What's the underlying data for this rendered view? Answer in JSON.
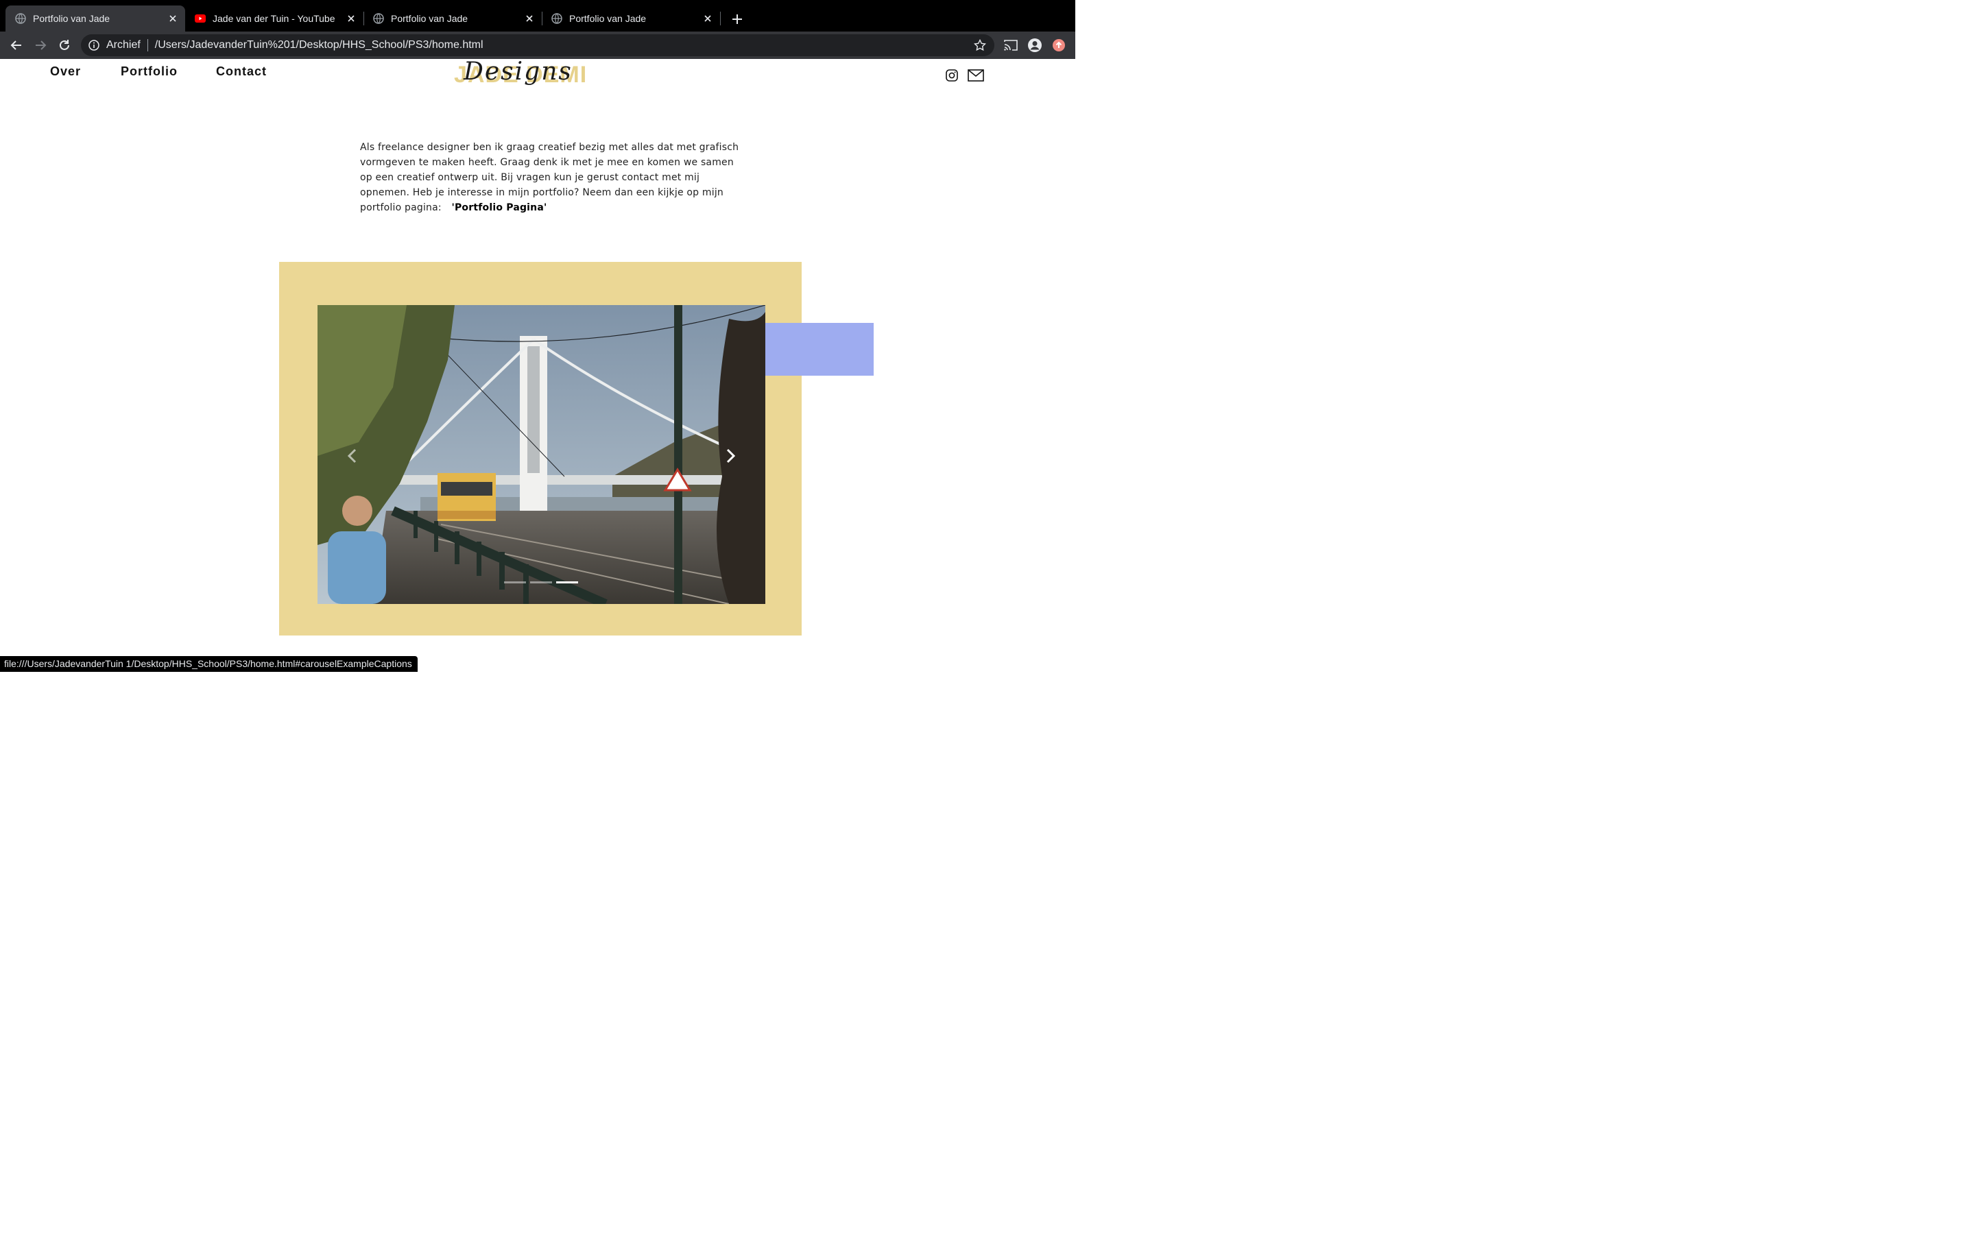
{
  "browser": {
    "tabs": [
      {
        "title": "Portfolio van Jade",
        "favicon": "globe-icon",
        "active": true
      },
      {
        "title": "Jade van der Tuin - YouTube",
        "favicon": "youtube-icon",
        "active": false
      },
      {
        "title": "Portfolio van Jade",
        "favicon": "globe-icon",
        "active": false
      },
      {
        "title": "Portfolio van Jade",
        "favicon": "globe-icon",
        "active": false
      }
    ],
    "security_chip": "Archief",
    "url": "/Users/JadevanderTuin%201/Desktop/HHS_School/PS3/home.html",
    "status_url": "file:///Users/JadevanderTuin 1/Desktop/HHS_School/PS3/home.html#carouselExampleCaptions"
  },
  "site": {
    "nav": {
      "over": "Over",
      "portfolio": "Portfolio",
      "contact": "Contact"
    },
    "logo": {
      "block_text": "JADE DEMI",
      "script_text": "Designs"
    },
    "social": [
      "instagram-icon",
      "mail-icon"
    ],
    "intro": {
      "text": "Als freelance designer ben ik graag creatief bezig met alles dat met grafisch vormgeven te maken heeft. Graag denk ik met je mee en komen we samen op een creatief ontwerp uit. Bij vragen kun je gerust contact met mij opnemen. Heb je interesse in mijn portfolio? Neem dan een kijkje op mijn portfolio pagina:",
      "link": "'Portfolio Pagina'"
    },
    "carousel": {
      "slide_count": 3,
      "active_index": 2,
      "slide_subject": "Budapest bridge with yellow tram"
    }
  },
  "colors": {
    "frame_yellow": "#ebd795",
    "accent_blue": "#9eacf0",
    "logo_gold": "#e6d18b",
    "chrome_dark": "#35363a"
  }
}
